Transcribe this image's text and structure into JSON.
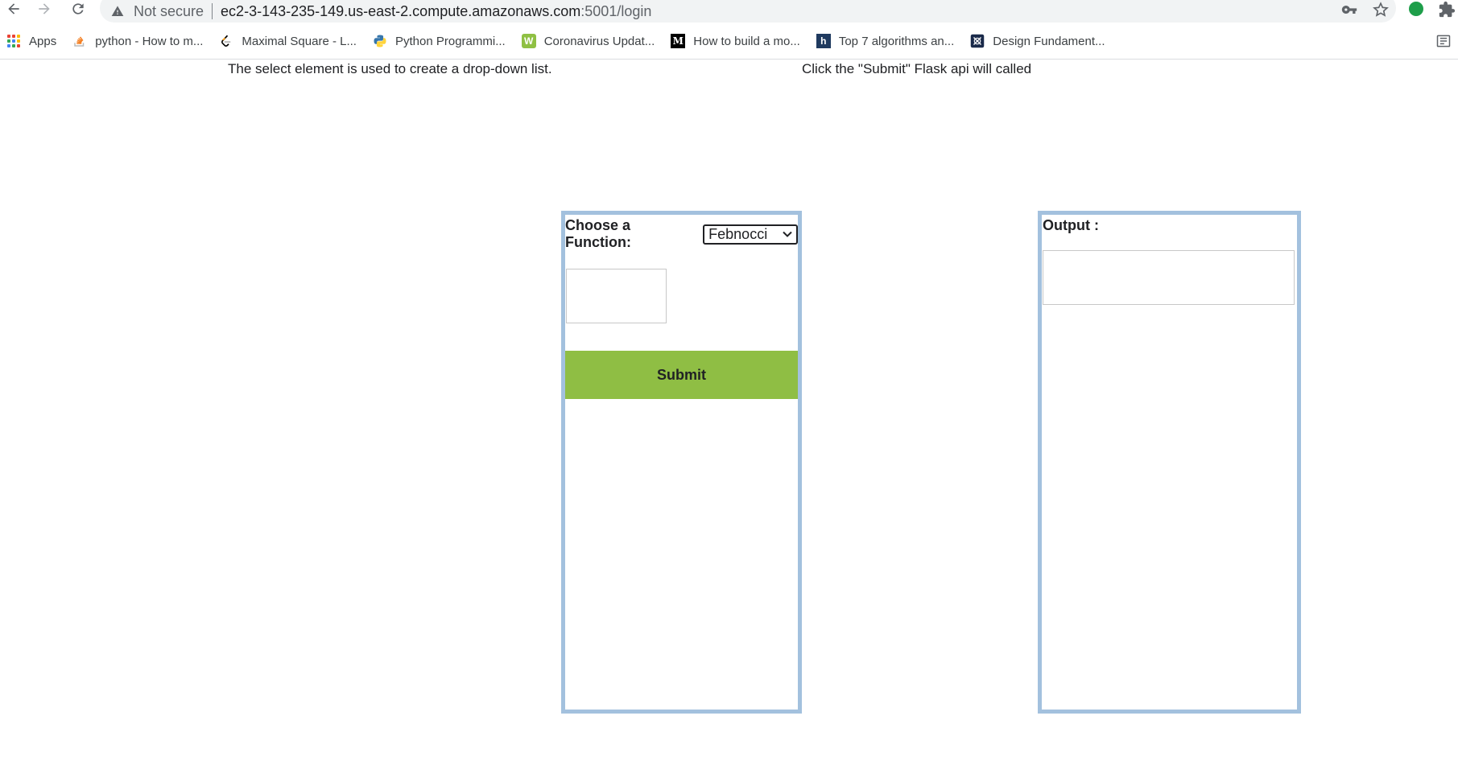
{
  "browser": {
    "security_label": "Not secure",
    "url_host": "ec2-3-143-235-149.us-east-2.compute.amazonaws.com",
    "url_path": ":5001/login",
    "ext_color": "#1e9e4a"
  },
  "bookmarks": [
    {
      "label": "Apps",
      "icon": "apps-grid-icon"
    },
    {
      "label": "python - How to m...",
      "icon": "stackoverflow-icon"
    },
    {
      "label": "Maximal Square - L...",
      "icon": "leetcode-icon"
    },
    {
      "label": "Python Programmi...",
      "icon": "python-icon"
    },
    {
      "label": "Coronavirus Updat...",
      "icon": "worldometer-icon"
    },
    {
      "label": "How to build a mo...",
      "icon": "medium-icon"
    },
    {
      "label": "Top 7 algorithms an...",
      "icon": "hackernoon-icon"
    },
    {
      "label": "Design Fundament...",
      "icon": "design-icon"
    }
  ],
  "page": {
    "intro_left": "The select element is used to create a drop-down list.",
    "intro_right": "Click the \"Submit\" Flask api will called",
    "form": {
      "choose_label": "Choose a Function:",
      "selected_function": "Febnocci",
      "input_value": "",
      "submit_label": "Submit"
    },
    "output": {
      "label": "Output :",
      "value": ""
    }
  },
  "colors": {
    "panel_border": "#a3c1de",
    "submit_bg": "#8fbe44"
  }
}
